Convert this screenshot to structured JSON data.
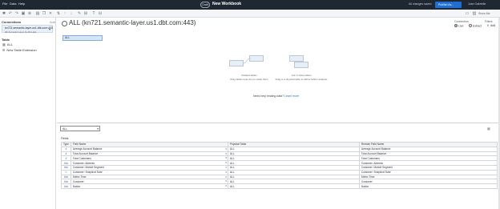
{
  "topbar": {
    "menu": [
      "File",
      "Data",
      "Help"
    ],
    "draft_badge": "Draft",
    "workbook_title": "New Workbook",
    "changes_status": "All changes saved",
    "publish_label": "Publish As...",
    "user_name": "Jose Gabrielle"
  },
  "toolbar": {
    "show_me": "Show Me"
  },
  "sidebar": {
    "connections_label": "Connections",
    "add_label": "Add",
    "connection_name": "kn721.semantic-layer.us1.dbt.com:443",
    "connection_sub": "dbt Semantic Layer by dbt Labs",
    "table_label": "Table",
    "items": [
      {
        "label": "ALL"
      },
      {
        "label": "New Table Extension"
      }
    ]
  },
  "main": {
    "title": "ALL (kn721.semantic-layer.us1.dbt.com:443)",
    "connection_label": "Connection",
    "conn_live": "Live",
    "conn_extract": "Extract",
    "filters_label": "Filters",
    "filters_count": "0",
    "filters_add": "Add",
    "canvas_table": "ALL",
    "illus_left_title": "Related tables",
    "illus_left_desc": "Drag tables near ALL to relate them",
    "illus_right_title": "Join in base tables",
    "illus_right_desc": "Drag to a physical table to define further analysis",
    "help_text": "Need help relating data?",
    "help_link": "Learn more"
  },
  "grid": {
    "table_select": "ALL",
    "fields_label": "Fields",
    "columns": [
      "Type",
      "Field Name",
      "Physical Table",
      "Remote Field Name"
    ],
    "rows": [
      {
        "type": "#",
        "field": "Average Account Balance",
        "table": "ALL",
        "remote": "Average Account Balance"
      },
      {
        "type": "#",
        "field": "Total Account Balance",
        "table": "ALL",
        "remote": "Total Account Balance"
      },
      {
        "type": "#",
        "field": "Total Customers",
        "table": "ALL",
        "remote": "Total Customers"
      },
      {
        "type": "Abc",
        "field": "Customer: Address",
        "table": "ALL",
        "remote": "Customer: Address"
      },
      {
        "type": "Abc",
        "field": "Customer: Market Segment",
        "table": "ALL",
        "remote": "Customer: Market Segment"
      },
      {
        "type": "▭",
        "field": "Customer: Snapshot Date",
        "table": "ALL",
        "remote": "Customer: Snapshot Date"
      },
      {
        "type": "Abc",
        "field": "Metric Time",
        "table": "ALL",
        "remote": "Metric Time"
      },
      {
        "type": "Abc",
        "field": "Customer",
        "table": "ALL",
        "remote": "Customer"
      },
      {
        "type": "Abc",
        "field": "Nation",
        "table": "ALL",
        "remote": "Nation"
      }
    ]
  },
  "colors": {
    "topbar_bg": "#1f2733",
    "accent": "#1f6fd1",
    "pill_bg": "#d6e6f7"
  }
}
